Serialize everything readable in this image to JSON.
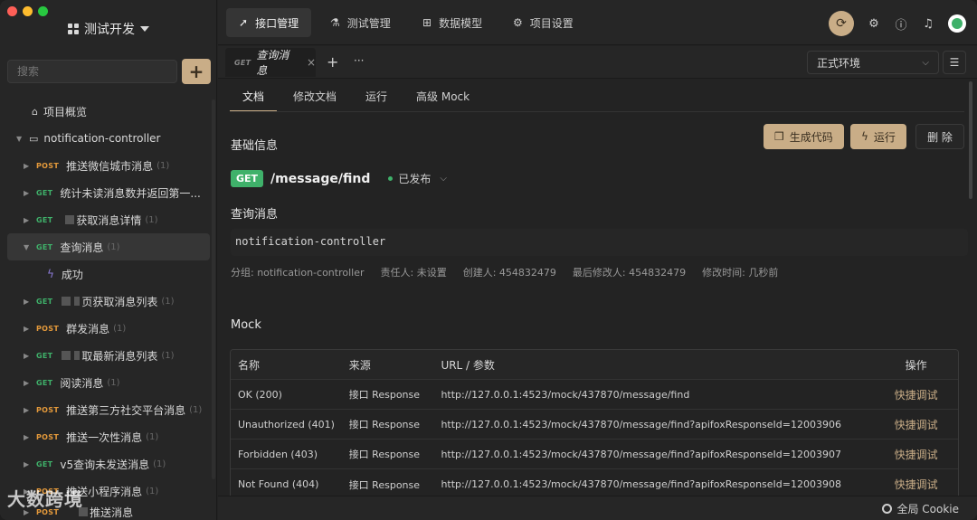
{
  "colors": {
    "accent": "#c9ad87",
    "get": "#3fb16a",
    "post": "#e59a3b",
    "bg": "#232323"
  },
  "sidebar": {
    "project_name": "测试开发",
    "search_placeholder": "搜索",
    "add_label": "+",
    "overview": "项目概览",
    "folder": "notification-controller",
    "items": [
      {
        "method": "POST",
        "label": "推送微信城市消息",
        "count": "(1)"
      },
      {
        "method": "GET",
        "label": "统计未读消息数并返回第一...",
        "count": ""
      },
      {
        "method": "GET",
        "label": "获取消息详情",
        "count": "(1)"
      },
      {
        "method": "GET",
        "label": "查询消息",
        "count": "(1)"
      },
      {
        "method": "",
        "label": "成功",
        "count": ""
      },
      {
        "method": "GET",
        "label": "页获取消息列表",
        "count": "(1)"
      },
      {
        "method": "POST",
        "label": "群发消息",
        "count": "(1)"
      },
      {
        "method": "GET",
        "label": "取最新消息列表",
        "count": "(1)"
      },
      {
        "method": "GET",
        "label": "阅读消息",
        "count": "(1)"
      },
      {
        "method": "POST",
        "label": "推送第三方社交平台消息",
        "count": "(1)"
      },
      {
        "method": "POST",
        "label": "推送一次性消息",
        "count": "(1)"
      },
      {
        "method": "GET",
        "label": "v5查询未发送消息",
        "count": "(1)"
      },
      {
        "method": "POST",
        "label": "推送小程序消息",
        "count": "(1)"
      },
      {
        "method": "POST",
        "label": "推送消息",
        "count": ""
      }
    ],
    "watermark": "大数跨境"
  },
  "topbar": {
    "tabs": [
      "接口管理",
      "测试管理",
      "数据模型",
      "项目设置"
    ]
  },
  "docbar": {
    "tab_method": "GET",
    "tab_name": "查询消息",
    "close": "×",
    "plus": "+",
    "more": "···",
    "env": "正式环境"
  },
  "main": {
    "subtabs": [
      "文档",
      "修改文档",
      "运行",
      "高级 Mock"
    ],
    "basic_info_title": "基础信息",
    "btn_gen_code": "生成代码",
    "btn_run": "运行",
    "btn_delete": "删 除",
    "method": "GET",
    "path": "/message/find",
    "status": "已发布",
    "api_name": "查询消息",
    "description": "notification-controller",
    "meta": {
      "group": "分组: notification-controller",
      "owner": "责任人: 未设置",
      "creator": "创建人: 454832479",
      "modifier": "最后修改人: 454832479",
      "modified_time": "修改时间: 几秒前"
    },
    "mock_title": "Mock",
    "table": {
      "headers": [
        "名称",
        "来源",
        "URL / 参数",
        "操作"
      ],
      "rows": [
        {
          "name": "OK (200)",
          "source": "接口 Response",
          "url": "http://127.0.0.1:4523/mock/437870/message/find",
          "action": "快捷调试"
        },
        {
          "name": "Unauthorized (401)",
          "source": "接口 Response",
          "url": "http://127.0.0.1:4523/mock/437870/message/find?apifoxResponseId=12003906",
          "action": "快捷调试"
        },
        {
          "name": "Forbidden (403)",
          "source": "接口 Response",
          "url": "http://127.0.0.1:4523/mock/437870/message/find?apifoxResponseId=12003907",
          "action": "快捷调试"
        },
        {
          "name": "Not Found (404)",
          "source": "接口 Response",
          "url": "http://127.0.0.1:4523/mock/437870/message/find?apifoxResponseId=12003908",
          "action": "快捷调试"
        }
      ]
    }
  },
  "statusbar": {
    "cookie": "全局 Cookie"
  }
}
